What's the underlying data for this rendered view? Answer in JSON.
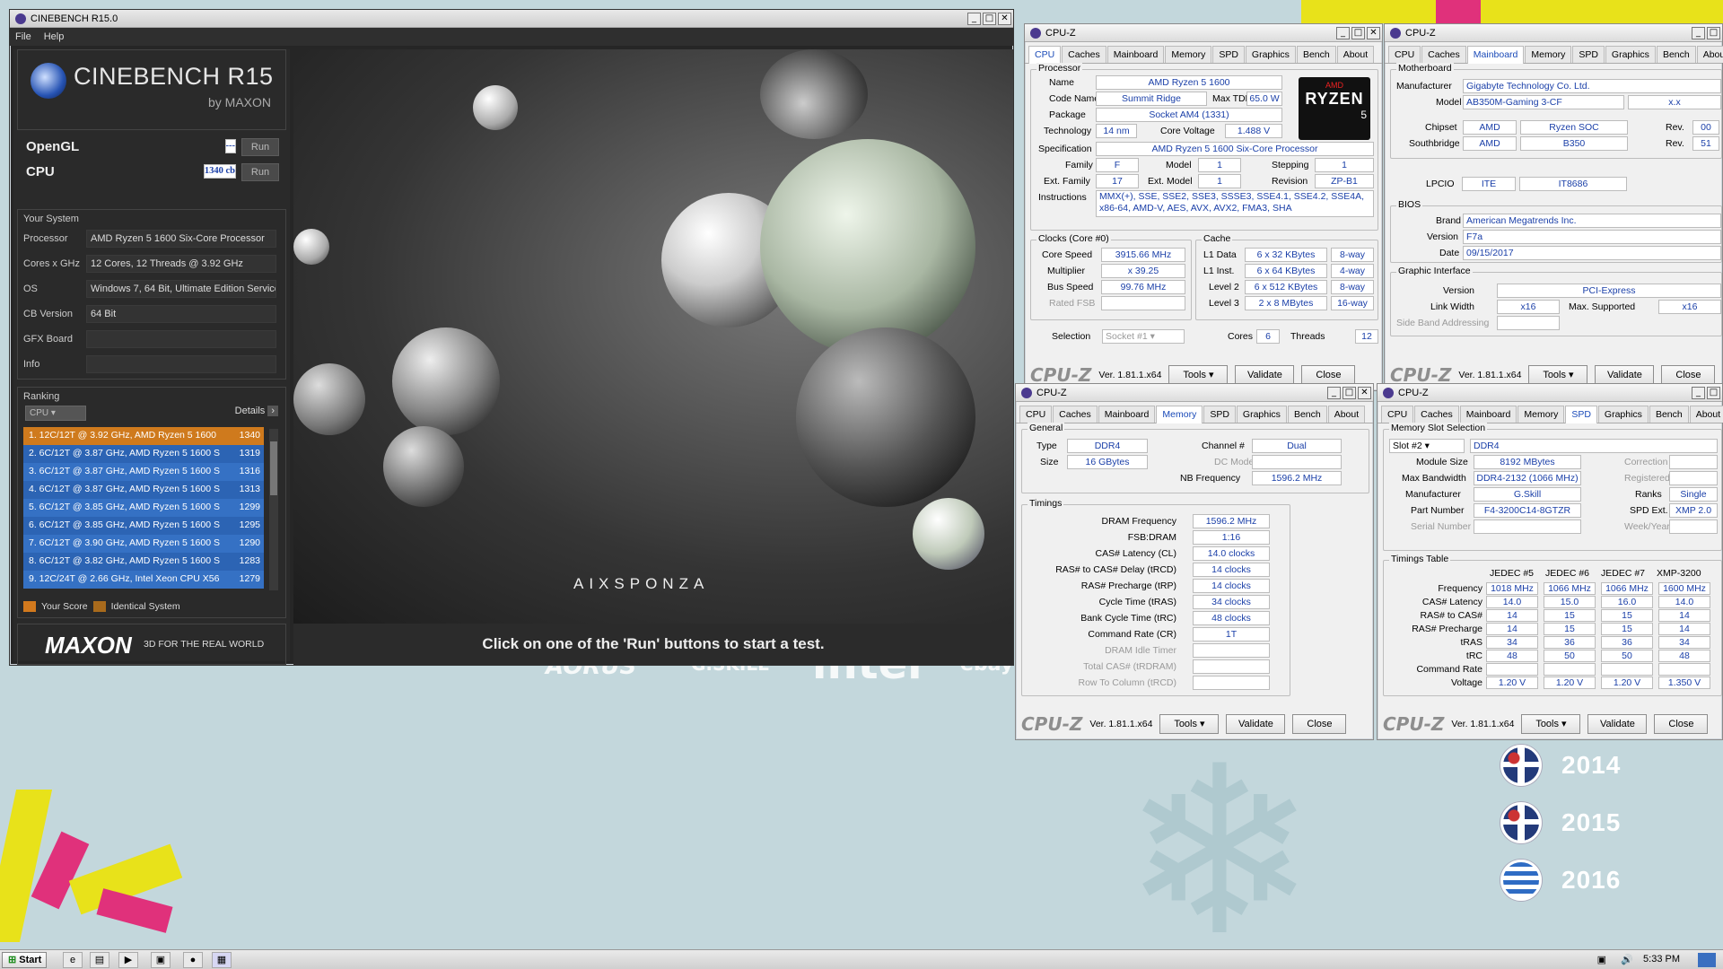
{
  "desktop": {
    "years": [
      "2014",
      "2015",
      "2016"
    ],
    "sponsors": [
      "AORUS",
      "G.SKILL",
      "intel",
      "ebay"
    ]
  },
  "cinebench": {
    "title": "CINEBENCH R15.0",
    "menu": [
      "File",
      "Help"
    ],
    "logo": {
      "name": "CINEBENCH R15",
      "by": "by MAXON"
    },
    "opengl": {
      "label": "OpenGL",
      "value": "---",
      "run": "Run"
    },
    "cpu": {
      "label": "CPU",
      "value": "1340 cb",
      "run": "Run"
    },
    "system": {
      "title": "Your System",
      "rows": [
        {
          "k": "Processor",
          "v": "AMD Ryzen 5 1600 Six-Core Processor"
        },
        {
          "k": "Cores x GHz",
          "v": "12 Cores, 12 Threads @ 3.92 GHz"
        },
        {
          "k": "OS",
          "v": "Windows 7, 64 Bit, Ultimate Edition Service"
        },
        {
          "k": "CB Version",
          "v": "64 Bit"
        },
        {
          "k": "GFX Board",
          "v": ""
        },
        {
          "k": "Info",
          "v": ""
        }
      ]
    },
    "ranking": {
      "title": "Ranking",
      "select": "CPU",
      "details": "Details",
      "rows": [
        {
          "t": "1. 12C/12T @ 3.92 GHz, AMD Ryzen 5 1600",
          "s": "1340",
          "hl": "orange"
        },
        {
          "t": "2. 6C/12T @ 3.87 GHz, AMD Ryzen 5 1600 S",
          "s": "1319",
          "hl": "blue"
        },
        {
          "t": "3. 6C/12T @ 3.87 GHz, AMD Ryzen 5 1600 S",
          "s": "1316",
          "hl": "blue"
        },
        {
          "t": "4. 6C/12T @ 3.87 GHz, AMD Ryzen 5 1600 S",
          "s": "1313",
          "hl": "blue"
        },
        {
          "t": "5. 6C/12T @ 3.85 GHz, AMD Ryzen 5 1600 S",
          "s": "1299",
          "hl": "blue"
        },
        {
          "t": "6. 6C/12T @ 3.85 GHz, AMD Ryzen 5 1600 S",
          "s": "1295",
          "hl": "blue"
        },
        {
          "t": "7. 6C/12T @ 3.90 GHz, AMD Ryzen 5 1600 S",
          "s": "1290",
          "hl": "blue"
        },
        {
          "t": "8. 6C/12T @ 3.82 GHz, AMD Ryzen 5 1600 S",
          "s": "1283",
          "hl": "blue"
        },
        {
          "t": "9. 12C/24T @ 2.66 GHz, Intel Xeon CPU X56",
          "s": "1279",
          "hl": "blue"
        }
      ],
      "legend_score": "Your Score",
      "legend_identical": "Identical System"
    },
    "footer": {
      "brand": "MAXON",
      "tagline": "3D FOR THE REAL WORLD"
    },
    "render_watermark": "AIXSPONZA",
    "caption": "Click on one of the 'Run' buttons to start a test."
  },
  "cpuz_common": {
    "title": "CPU-Z",
    "logo": "CPU-Z",
    "version": "Ver. 1.81.1.x64",
    "tools": "Tools",
    "validate": "Validate",
    "close": "Close",
    "tabs": [
      "CPU",
      "Caches",
      "Mainboard",
      "Memory",
      "SPD",
      "Graphics",
      "Bench",
      "About"
    ]
  },
  "cpuz_cpu": {
    "processor_title": "Processor",
    "name_l": "Name",
    "name": "AMD Ryzen 5 1600",
    "code_l": "Code Name",
    "code": "Summit Ridge",
    "tdp_l": "Max TDP",
    "tdp": "65.0 W",
    "pkg_l": "Package",
    "pkg": "Socket AM4 (1331)",
    "tech_l": "Technology",
    "tech": "14 nm",
    "cv_l": "Core Voltage",
    "cv": "1.488 V",
    "spec_l": "Specification",
    "spec": "AMD Ryzen 5 1600 Six-Core Processor",
    "fam_l": "Family",
    "fam": "F",
    "model_l": "Model",
    "model": "1",
    "step_l": "Stepping",
    "step": "1",
    "efam_l": "Ext. Family",
    "efam": "17",
    "emod_l": "Ext. Model",
    "emod": "1",
    "rev_l": "Revision",
    "rev": "ZP-B1",
    "instr_l": "Instructions",
    "instr1": "MMX(+), SSE, SSE2, SSE3, SSSE3, SSE4.1, SSE4.2, SSE4A,",
    "instr2": "x86-64, AMD-V, AES, AVX, AVX2, FMA3, SHA",
    "clocks_title": "Clocks (Core #0)",
    "cs_l": "Core Speed",
    "cs": "3915.66 MHz",
    "mul_l": "Multiplier",
    "mul": "x 39.25",
    "bus_l": "Bus Speed",
    "bus": "99.76 MHz",
    "fsb_l": "Rated FSB",
    "cache_title": "Cache",
    "l1d_l": "L1 Data",
    "l1d": "6 x 32 KBytes",
    "l1d_w": "8-way",
    "l1i_l": "L1 Inst.",
    "l1i": "6 x 64 KBytes",
    "l1i_w": "4-way",
    "l2_l": "Level 2",
    "l2": "6 x 512 KBytes",
    "l2_w": "8-way",
    "l3_l": "Level 3",
    "l3": "2 x 8 MBytes",
    "l3_w": "16-way",
    "sel_l": "Selection",
    "sel": "Socket #1",
    "cores_l": "Cores",
    "cores": "6",
    "thr_l": "Threads",
    "thr": "12",
    "badge_top": "AMD",
    "badge_mid": "RYZEN",
    "badge_num": "5"
  },
  "cpuz_mb": {
    "mb_title": "Motherboard",
    "man_l": "Manufacturer",
    "man": "Gigabyte Technology Co. Ltd.",
    "model_l": "Model",
    "model": "AB350M-Gaming 3-CF",
    "model2": "x.x",
    "chip_l": "Chipset",
    "chip_v": "AMD",
    "chip_m": "Ryzen SOC",
    "rev_l": "Rev.",
    "chip_r": "00",
    "sb_l": "Southbridge",
    "sb_v": "AMD",
    "sb_m": "B350",
    "sb_r": "51",
    "lpc_l": "LPCIO",
    "lpc_v": "ITE",
    "lpc_m": "IT8686",
    "bios_title": "BIOS",
    "brand_l": "Brand",
    "brand": "American Megatrends Inc.",
    "ver_l": "Version",
    "ver": "F7a",
    "date_l": "Date",
    "date": "09/15/2017",
    "gi_title": "Graphic Interface",
    "giv_l": "Version",
    "giv": "PCI-Express",
    "lw_l": "Link Width",
    "lw": "x16",
    "ms_l": "Max. Supported",
    "ms": "x16",
    "sba_l": "Side Band Addressing"
  },
  "cpuz_mem": {
    "gen_title": "General",
    "type_l": "Type",
    "type": "DDR4",
    "size_l": "Size",
    "size": "16 GBytes",
    "ch_l": "Channel #",
    "ch": "Dual",
    "dc_l": "DC Mode",
    "nb_l": "NB Frequency",
    "nb": "1596.2 MHz",
    "tim_title": "Timings",
    "rows": [
      {
        "k": "DRAM Frequency",
        "v": "1596.2 MHz",
        "g": false
      },
      {
        "k": "FSB:DRAM",
        "v": "1:16",
        "g": false
      },
      {
        "k": "CAS# Latency (CL)",
        "v": "14.0 clocks",
        "g": false
      },
      {
        "k": "RAS# to CAS# Delay (tRCD)",
        "v": "14 clocks",
        "g": false
      },
      {
        "k": "RAS# Precharge (tRP)",
        "v": "14 clocks",
        "g": false
      },
      {
        "k": "Cycle Time (tRAS)",
        "v": "34 clocks",
        "g": false
      },
      {
        "k": "Bank Cycle Time (tRC)",
        "v": "48 clocks",
        "g": false
      },
      {
        "k": "Command Rate (CR)",
        "v": "1T",
        "g": false
      },
      {
        "k": "DRAM Idle Timer",
        "v": "",
        "g": true
      },
      {
        "k": "Total CAS# (tRDRAM)",
        "v": "",
        "g": true
      },
      {
        "k": "Row To Column (tRCD)",
        "v": "",
        "g": true
      }
    ]
  },
  "cpuz_spd": {
    "mss_title": "Memory Slot Selection",
    "slot": "Slot #2",
    "slot_type": "DDR4",
    "ms_l": "Module Size",
    "ms": "8192 MBytes",
    "corr_l": "Correction",
    "mb_l": "Max Bandwidth",
    "mb": "DDR4-2132 (1066 MHz)",
    "reg_l": "Registered",
    "man_l": "Manufacturer",
    "man": "G.Skill",
    "ranks_l": "Ranks",
    "ranks": "Single",
    "pn_l": "Part Number",
    "pn": "F4-3200C14-8GTZR",
    "spd_l": "SPD Ext.",
    "spd": "XMP 2.0",
    "sn_l": "Serial Number",
    "wy_l": "Week/Year",
    "tt_title": "Timings Table",
    "cols": [
      "JEDEC #5",
      "JEDEC #6",
      "JEDEC #7",
      "XMP-3200"
    ],
    "rows": [
      {
        "k": "Frequency",
        "v": [
          "1018 MHz",
          "1066 MHz",
          "1066 MHz",
          "1600 MHz"
        ]
      },
      {
        "k": "CAS# Latency",
        "v": [
          "14.0",
          "15.0",
          "16.0",
          "14.0"
        ]
      },
      {
        "k": "RAS# to CAS#",
        "v": [
          "14",
          "15",
          "15",
          "14"
        ]
      },
      {
        "k": "RAS# Precharge",
        "v": [
          "14",
          "15",
          "15",
          "14"
        ]
      },
      {
        "k": "tRAS",
        "v": [
          "34",
          "36",
          "36",
          "34"
        ]
      },
      {
        "k": "tRC",
        "v": [
          "48",
          "50",
          "50",
          "48"
        ]
      },
      {
        "k": "Command Rate",
        "v": [
          "",
          "",
          "",
          ""
        ]
      },
      {
        "k": "Voltage",
        "v": [
          "1.20 V",
          "1.20 V",
          "1.20 V",
          "1.350 V"
        ]
      }
    ]
  },
  "taskbar": {
    "start": "Start",
    "clock": "5:33 PM"
  }
}
